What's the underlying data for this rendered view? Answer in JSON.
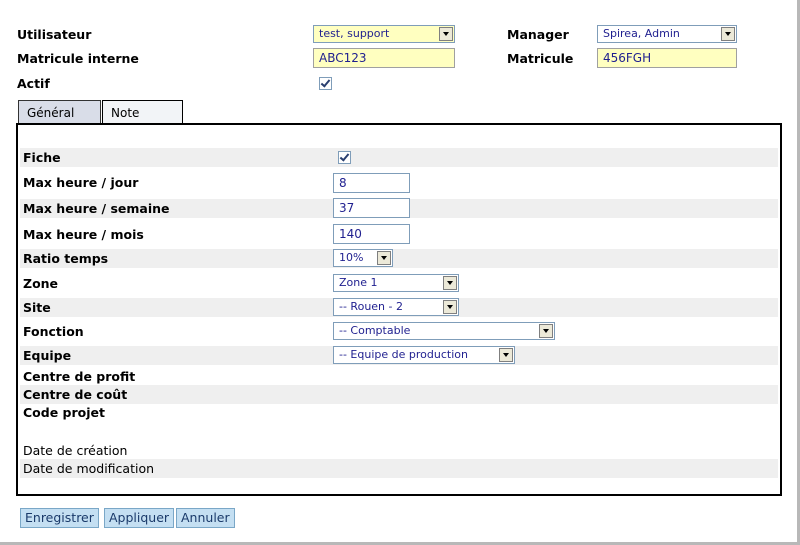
{
  "header": {
    "utilisateur": {
      "label": "Utilisateur",
      "value": "test, support"
    },
    "manager": {
      "label": "Manager",
      "value": "Spirea, Admin"
    },
    "matricule_interne": {
      "label": "Matricule interne",
      "value": "ABC123"
    },
    "matricule": {
      "label": "Matricule",
      "value": "456FGH"
    },
    "actif": {
      "label": "Actif",
      "checked": true
    }
  },
  "tabs": [
    {
      "label": "Général",
      "active": true
    },
    {
      "label": "Note",
      "active": false
    }
  ],
  "fields": {
    "fiche": {
      "label": "Fiche",
      "checked": true
    },
    "max_jour": {
      "label": "Max heure / jour",
      "value": "8"
    },
    "max_semaine": {
      "label": "Max heure / semaine",
      "value": "37"
    },
    "max_mois": {
      "label": "Max heure / mois",
      "value": "140"
    },
    "ratio": {
      "label": "Ratio temps",
      "value": "10%"
    },
    "zone": {
      "label": "Zone",
      "value": "Zone 1"
    },
    "site": {
      "label": "Site",
      "value": "-- Rouen - 2"
    },
    "fonction": {
      "label": "Fonction",
      "value": "-- Comptable"
    },
    "equipe": {
      "label": "Equipe",
      "value": "-- Equipe de production"
    },
    "centre_profit": {
      "label": "Centre de profit"
    },
    "centre_cout": {
      "label": "Centre de coût"
    },
    "code_projet": {
      "label": "Code projet"
    },
    "date_creation": {
      "label": "Date de création"
    },
    "date_modification": {
      "label": "Date de modification"
    }
  },
  "buttons": {
    "save": "Enregistrer",
    "apply": "Appliquer",
    "cancel": "Annuler"
  },
  "colors": {
    "input_highlight": "#ffffc0",
    "button_bg": "#c4dff2",
    "active_tab": "#d9dde8",
    "row_shade": "#efefef"
  }
}
